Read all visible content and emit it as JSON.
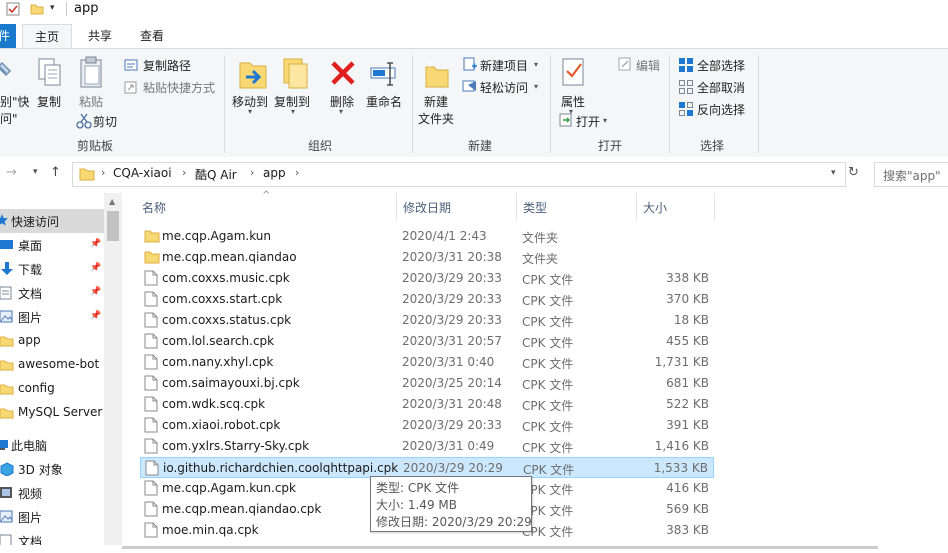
{
  "window": {
    "title": "app"
  },
  "ribbon_tabs": {
    "file": "件",
    "home": "主页",
    "share": "共享",
    "view": "查看"
  },
  "ribbon": {
    "clipboard": {
      "group_label": "剪贴板",
      "pin_quick_access_cut": "别\"快",
      "pin_quick_access_cut2": "问\"",
      "copy": "复制",
      "paste": "粘贴",
      "copy_path": "复制路径",
      "paste_shortcut": "粘贴快捷方式",
      "cut": "剪切"
    },
    "organize": {
      "group_label": "组织",
      "move_to": "移动到",
      "copy_to": "复制到",
      "delete": "删除",
      "rename": "重命名"
    },
    "new": {
      "group_label": "新建",
      "new_folder_1": "新建",
      "new_folder_2": "文件夹",
      "new_item": "新建项目",
      "easy_access": "轻松访问"
    },
    "open": {
      "group_label": "打开",
      "properties": "属性",
      "open": "打开",
      "edit": "编辑"
    },
    "select": {
      "group_label": "选择",
      "select_all": "全部选择",
      "select_none": "全部取消",
      "invert": "反向选择"
    }
  },
  "address": {
    "crumbs": [
      "CQA-xiaoi",
      "酷Q Air",
      "app"
    ],
    "search_placeholder": "搜索\"app\""
  },
  "nav": {
    "quick_access": "快速访问",
    "items": [
      {
        "label": "桌面",
        "pinned": true
      },
      {
        "label": "下载",
        "pinned": true
      },
      {
        "label": "文档",
        "pinned": true
      },
      {
        "label": "图片",
        "pinned": true
      },
      {
        "label": "app",
        "pinned": false
      },
      {
        "label": "awesome-bot",
        "pinned": false
      },
      {
        "label": "config",
        "pinned": false
      },
      {
        "label": "MySQL Server",
        "pinned": false
      }
    ],
    "this_pc": "此电脑",
    "pc_items": [
      "3D 对象",
      "视频",
      "图片",
      "文档"
    ]
  },
  "columns": {
    "name": "名称",
    "date": "修改日期",
    "type": "类型",
    "size": "大小"
  },
  "files": [
    {
      "name": "me.cqp.Agam.kun",
      "date": "2020/4/1 2:43",
      "type": "文件夹",
      "size": "",
      "kind": "folder"
    },
    {
      "name": "me.cqp.mean.qiandao",
      "date": "2020/3/31 20:38",
      "type": "文件夹",
      "size": "",
      "kind": "folder"
    },
    {
      "name": "com.coxxs.music.cpk",
      "date": "2020/3/29 20:33",
      "type": "CPK 文件",
      "size": "338 KB",
      "kind": "file"
    },
    {
      "name": "com.coxxs.start.cpk",
      "date": "2020/3/29 20:33",
      "type": "CPK 文件",
      "size": "370 KB",
      "kind": "file"
    },
    {
      "name": "com.coxxs.status.cpk",
      "date": "2020/3/29 20:33",
      "type": "CPK 文件",
      "size": "18 KB",
      "kind": "file"
    },
    {
      "name": "com.lol.search.cpk",
      "date": "2020/3/31 20:57",
      "type": "CPK 文件",
      "size": "455 KB",
      "kind": "file"
    },
    {
      "name": "com.nany.xhyl.cpk",
      "date": "2020/3/31 0:40",
      "type": "CPK 文件",
      "size": "1,731 KB",
      "kind": "file"
    },
    {
      "name": "com.saimayouxi.bj.cpk",
      "date": "2020/3/25 20:14",
      "type": "CPK 文件",
      "size": "681 KB",
      "kind": "file"
    },
    {
      "name": "com.wdk.scq.cpk",
      "date": "2020/3/31 20:48",
      "type": "CPK 文件",
      "size": "522 KB",
      "kind": "file"
    },
    {
      "name": "com.xiaoi.robot.cpk",
      "date": "2020/3/29 20:33",
      "type": "CPK 文件",
      "size": "391 KB",
      "kind": "file"
    },
    {
      "name": "com.yxlrs.Starry-Sky.cpk",
      "date": "2020/3/31 0:49",
      "type": "CPK 文件",
      "size": "1,416 KB",
      "kind": "file"
    },
    {
      "name": "io.github.richardchien.coolqhttpapi.cpk",
      "date": "2020/3/29 20:29",
      "type": "CPK 文件",
      "size": "1,533 KB",
      "kind": "file",
      "selected": true
    },
    {
      "name": "me.cqp.Agam.kun.cpk",
      "date": "",
      "type": "CPK 文件",
      "size": "416 KB",
      "kind": "file"
    },
    {
      "name": "me.cqp.mean.qiandao.cpk",
      "date": "",
      "type": "CPK 文件",
      "size": "569 KB",
      "kind": "file"
    },
    {
      "name": "moe.min.qa.cpk",
      "date": "",
      "type": "CPK 文件",
      "size": "383 KB",
      "kind": "file"
    }
  ],
  "tooltip": {
    "type_line": "类型: CPK 文件",
    "size_line": "大小: 1.49 MB",
    "date_line": "修改日期: 2020/3/29 20:29"
  },
  "colors": {
    "accent": "#1979ca",
    "selection": "#cce8ff",
    "folder": "#f8d775",
    "header_text": "#4c607a"
  }
}
